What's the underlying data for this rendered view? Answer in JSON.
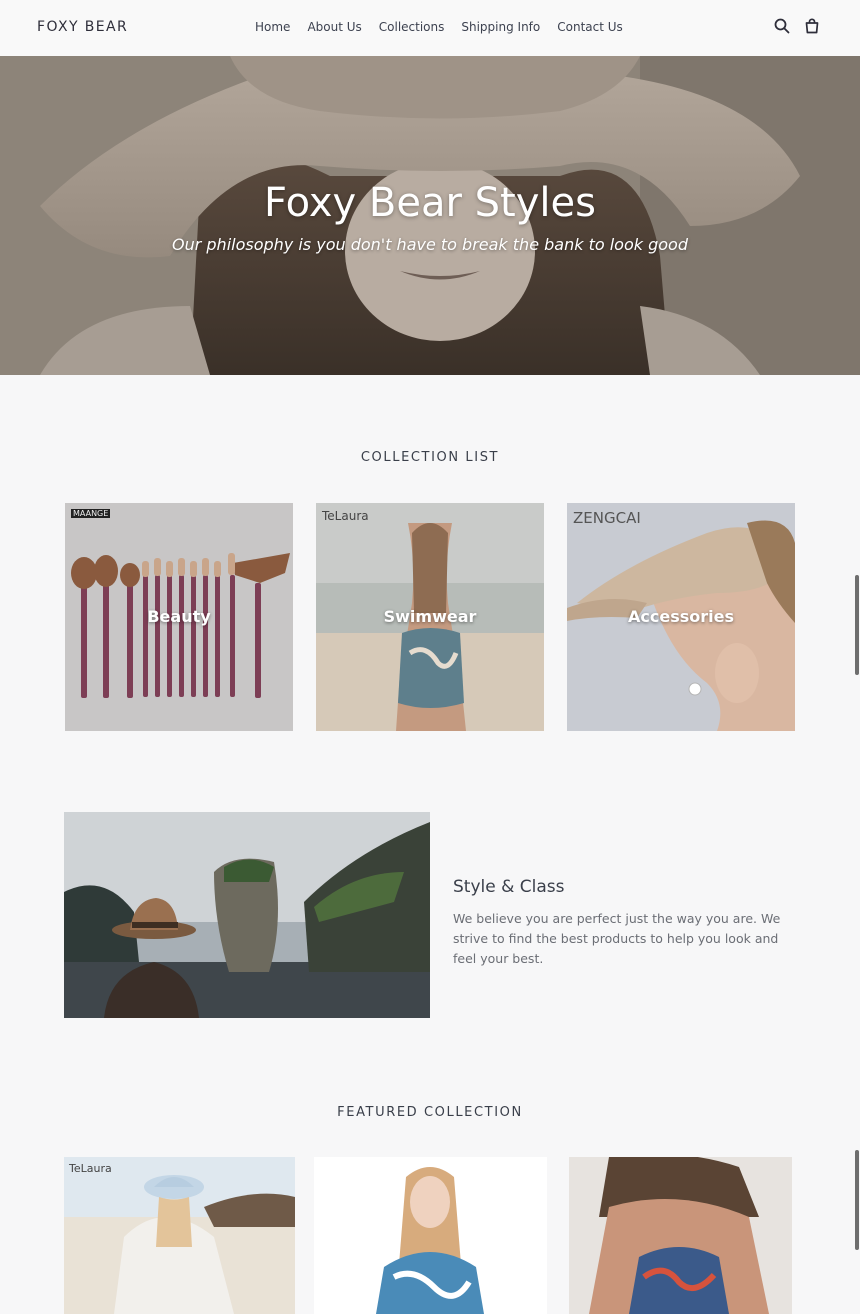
{
  "header": {
    "logo": "FOXY BEAR",
    "nav": [
      "Home",
      "About Us",
      "Collections",
      "Shipping Info",
      "Contact Us"
    ],
    "icons": [
      "search-icon",
      "cart-icon"
    ]
  },
  "hero": {
    "title": "Foxy Bear Styles",
    "subtitle": "Our philosophy is you don't have to break the bank to look good"
  },
  "collection_list": {
    "heading": "COLLECTION LIST",
    "items": [
      {
        "label": "Beauty",
        "brand": "MAANGE"
      },
      {
        "label": "Swimwear",
        "brand": "TeLaura"
      },
      {
        "label": "Accessories",
        "brand": "ZENGCAI"
      }
    ]
  },
  "feature": {
    "title": "Style & Class",
    "text": "We believe you are perfect just the way you are. We strive to find the best products to help you look and feel your best."
  },
  "featured_collection": {
    "heading": "FEATURED COLLECTION",
    "products": [
      {
        "brand": "TeLaura"
      },
      {
        "brand": ""
      },
      {
        "brand": ""
      }
    ]
  },
  "colors": {
    "background": "#f7f7f8",
    "text": "#3a3f4a",
    "muted": "#6b6e75"
  }
}
